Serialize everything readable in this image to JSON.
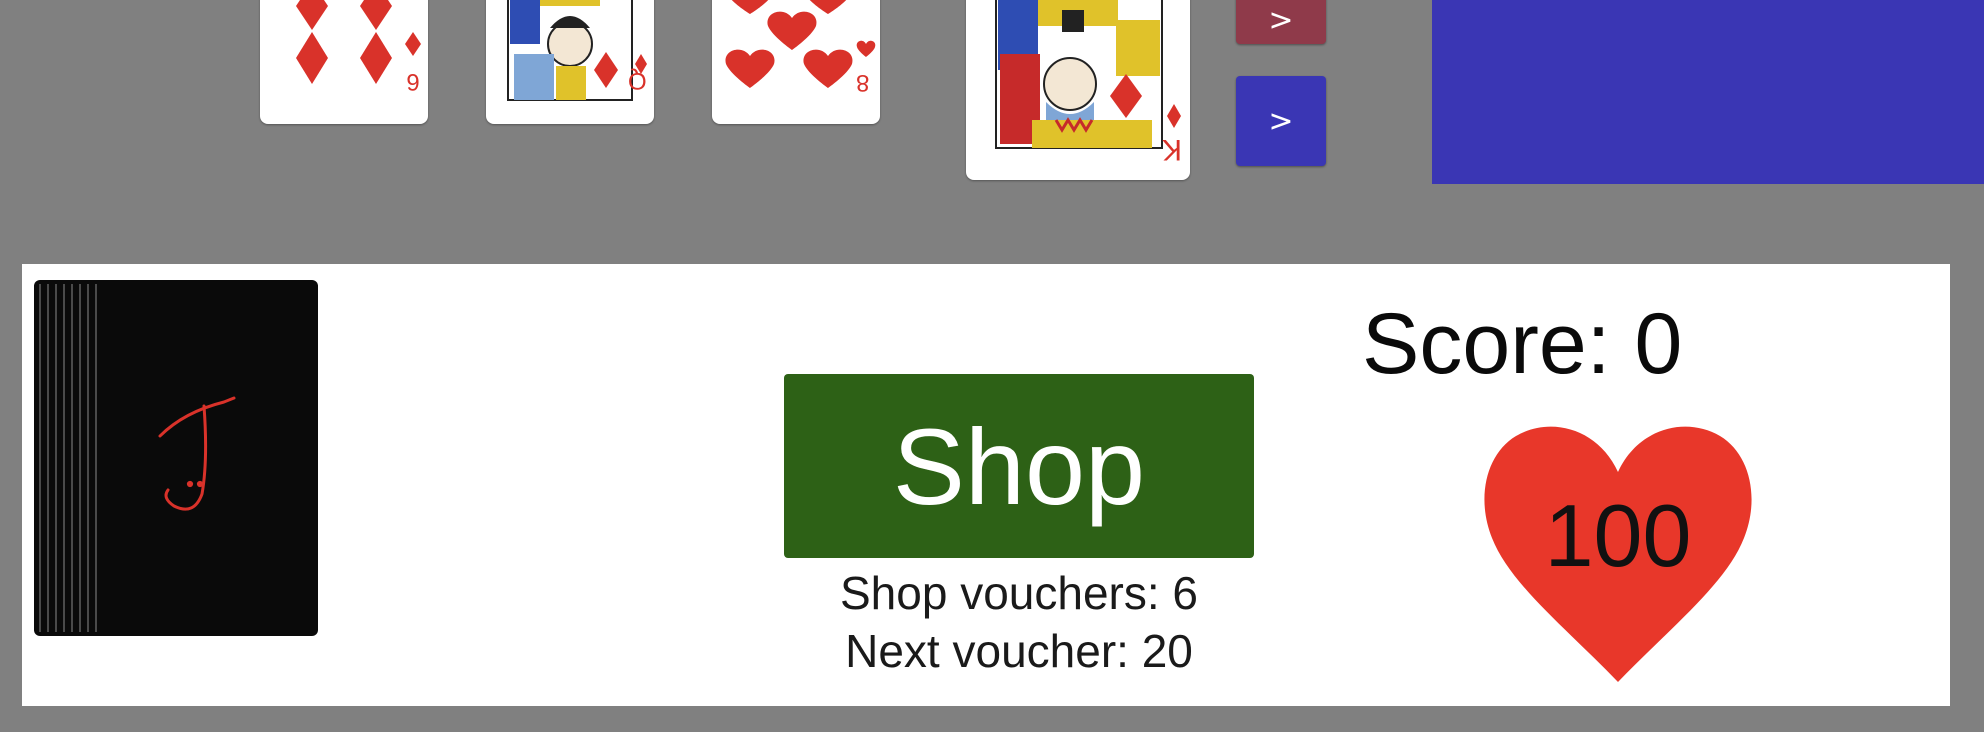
{
  "cards": [
    {
      "rank": "6",
      "suit": "diamonds",
      "suit_symbol": "♦",
      "color": "#d9322a"
    },
    {
      "rank": "Q",
      "suit": "diamonds",
      "suit_symbol": "♦",
      "color": "#d9322a"
    },
    {
      "rank": "8",
      "suit": "hearts",
      "suit_symbol": "♥",
      "color": "#d9322a"
    },
    {
      "rank": "K",
      "suit": "diamonds",
      "suit_symbol": "♦",
      "color": "#d9322a"
    }
  ],
  "buttons": {
    "arrow_top_label": ">",
    "arrow_top_color": "#8f3a4a",
    "arrow_bottom_label": ">",
    "arrow_bottom_color": "#3a36b4"
  },
  "panel_color": "#3a36b4",
  "deck": {
    "mark": "J",
    "face_color": "#0a0a0a",
    "mark_color": "#d9322a"
  },
  "shop": {
    "label": "Shop",
    "color": "#2d6116",
    "vouchers_text": "Shop vouchers: 6",
    "next_voucher_text": "Next voucher: 20"
  },
  "score": {
    "text": "Score: 0"
  },
  "health": {
    "value": "100",
    "color": "#e8372a"
  }
}
